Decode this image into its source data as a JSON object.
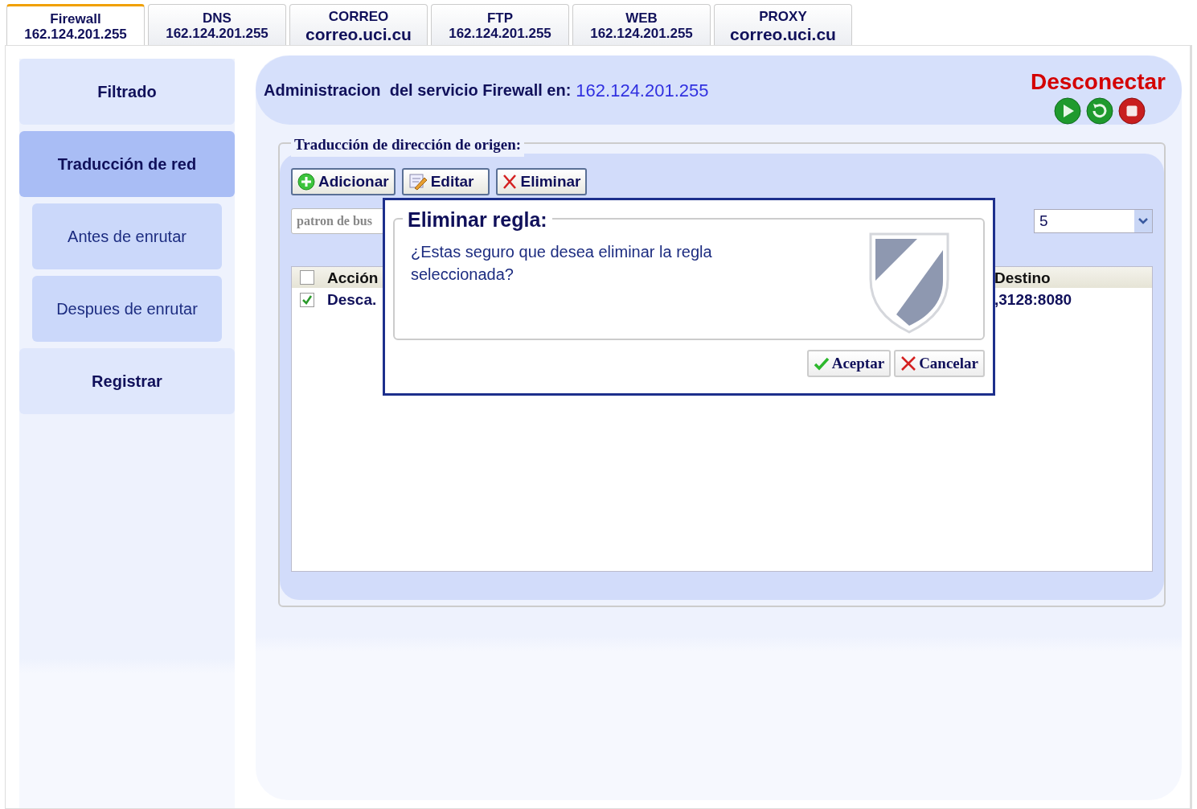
{
  "tabs": [
    {
      "name": "Firewall",
      "host": "162.124.201.255",
      "selected": true
    },
    {
      "name": "DNS",
      "host": "162.124.201.255",
      "selected": false
    },
    {
      "name": "CORREO",
      "host": "correo.uci.cu",
      "selected": false
    },
    {
      "name": "FTP",
      "host": "162.124.201.255",
      "selected": false
    },
    {
      "name": "WEB",
      "host": "162.124.201.255",
      "selected": false
    },
    {
      "name": "PROXY",
      "host": "correo.uci.cu",
      "selected": false
    }
  ],
  "sidebar": {
    "items": [
      {
        "label": "Filtrado",
        "selected": false
      },
      {
        "label": "Traducción de red",
        "selected": true,
        "children": [
          {
            "label": "Antes de enrutar",
            "selected": false
          },
          {
            "label": "Despues de enrutar",
            "selected": false
          }
        ]
      },
      {
        "label": "Registrar",
        "selected": false
      }
    ]
  },
  "header": {
    "title": "Administracion  del servicio Firewall en:",
    "address": "162.124.201.255",
    "disconnect": "Desconectar"
  },
  "section": {
    "legend": "Traducción de dirección de origen:",
    "buttons": [
      {
        "label": "Adicionar",
        "kind": "add"
      },
      {
        "label": "Editar",
        "kind": "edit"
      },
      {
        "label": "Eliminar",
        "kind": "delete"
      }
    ],
    "search": {
      "placeholder": "patron de bus"
    },
    "page_size": "5",
    "table": {
      "columns": [
        "Acción",
        "Destino"
      ],
      "header_checked": false,
      "rows": [
        {
          "checked": true,
          "cells": [
            "Desca.",
            ",3128:8080"
          ]
        }
      ]
    }
  },
  "dialog": {
    "title": "Eliminar regla:",
    "message": "¿Estas seguro que desea eliminar la regla seleccionada?",
    "buttons": [
      {
        "label": "Aceptar",
        "kind": "ok"
      },
      {
        "label": "Cancelar",
        "kind": "cancel"
      }
    ]
  }
}
